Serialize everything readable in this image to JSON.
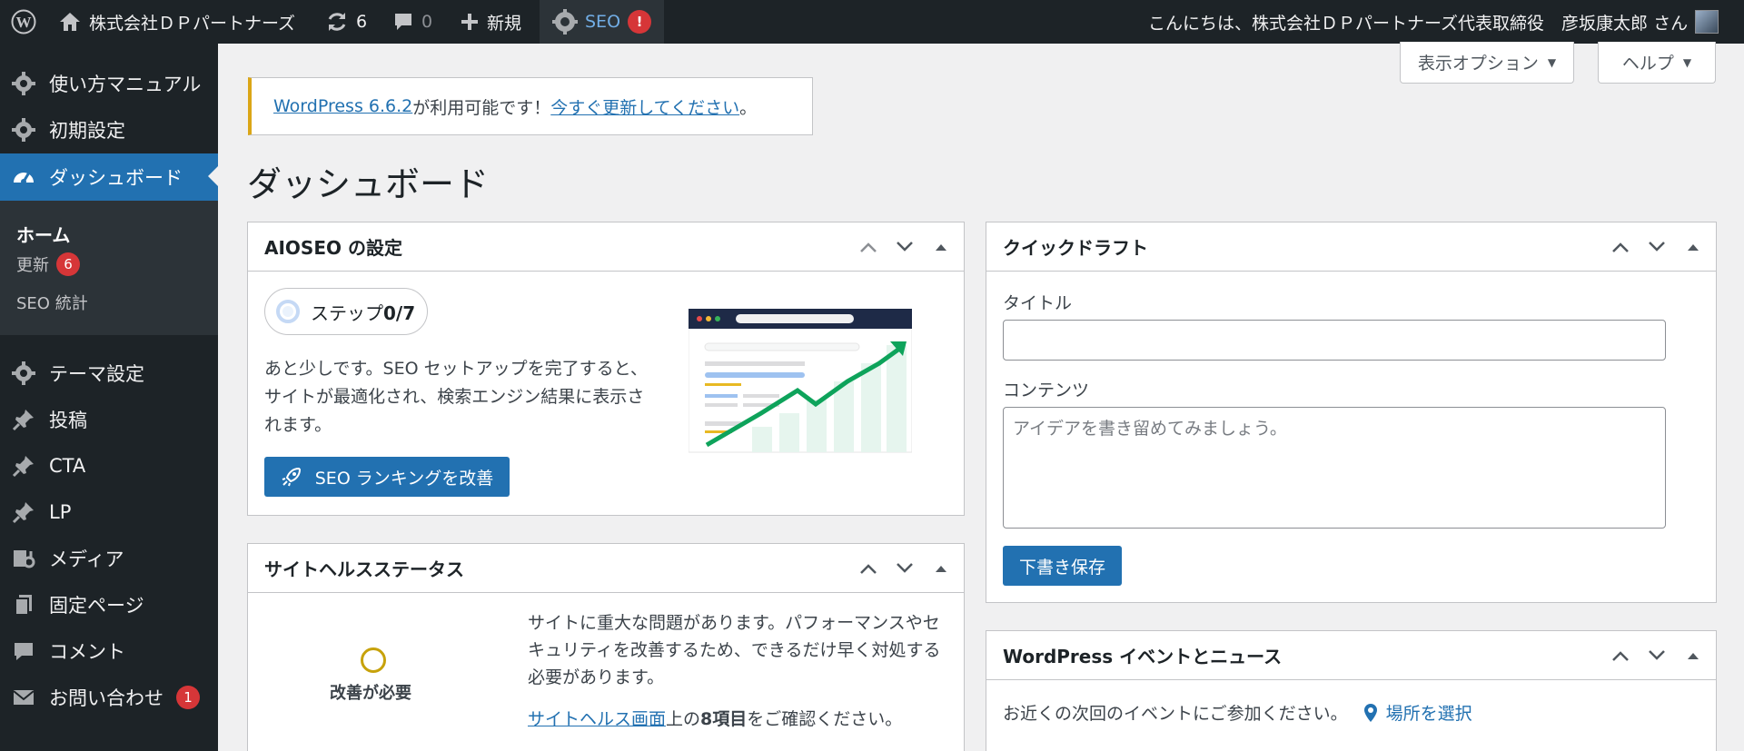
{
  "adminbar": {
    "site_name": "株式会社ＤＰパートナーズ",
    "updates_count": "6",
    "comments_count": "0",
    "new_label": "新規",
    "seo_label": "SEO",
    "seo_alert": "!",
    "greeting": "こんにちは、株式会社ＤＰパートナーズ代表取締役　彦坂康太郎 さん"
  },
  "sidebar": {
    "items": [
      {
        "label": "使い方マニュアル",
        "icon": "gear-icon"
      },
      {
        "label": "初期設定",
        "icon": "gear-icon"
      },
      {
        "label": "ダッシュボード",
        "icon": "dashboard-icon"
      },
      {
        "label": "テーマ設定",
        "icon": "gear-icon"
      },
      {
        "label": "投稿",
        "icon": "pin-icon"
      },
      {
        "label": "CTA",
        "icon": "pin-icon"
      },
      {
        "label": "LP",
        "icon": "pin-icon"
      },
      {
        "label": "メディア",
        "icon": "media-icon"
      },
      {
        "label": "固定ページ",
        "icon": "pages-icon"
      },
      {
        "label": "コメント",
        "icon": "comment-icon"
      },
      {
        "label": "お問い合わせ",
        "icon": "mail-icon",
        "badge": "1"
      }
    ],
    "submenu": [
      {
        "label": "ホーム"
      },
      {
        "label": "更新",
        "badge": "6"
      },
      {
        "label": "SEO 統計"
      }
    ]
  },
  "screen_options": {
    "label": "表示オプション",
    "help_label": "ヘルプ"
  },
  "notice": {
    "link1": "WordPress 6.6.2",
    "middle": " が利用可能です！",
    "link2": "今すぐ更新してください",
    "end": "。"
  },
  "page_title": "ダッシュボード",
  "aioseo": {
    "title": "AIOSEO の設定",
    "step_prefix": "ステップ",
    "step_value": "0/7",
    "text": "あと少しです。SEO セットアップを完了すると、サイトが最適化され、検索エンジン結果に表示されます。",
    "button": "SEO ランキングを改善"
  },
  "site_health": {
    "title": "サイトヘルスステータス",
    "status": "改善が必要",
    "text": "サイトに重大な問題があります。パフォーマンスやセキュリティを改善するため、できるだけ早く対処する必要があります。",
    "link": "サイトヘルス画面",
    "link_suffix_1": "上の",
    "link_count": "8項目",
    "link_suffix_2": "をご確認ください。"
  },
  "quick_draft": {
    "title": "クイックドラフト",
    "title_label": "タイトル",
    "content_label": "コンテンツ",
    "content_placeholder": "アイデアを書き留めてみましょう。",
    "save_button": "下書き保存"
  },
  "events": {
    "title": "WordPress イベントとニュース",
    "text": "お近くの次回のイベントにご参加ください。",
    "location_link": "場所を選択"
  },
  "colors": {
    "adminbar_bg": "#1d2327",
    "accent": "#2271b1",
    "badge": "#d63638",
    "notice_border": "#dba617"
  }
}
